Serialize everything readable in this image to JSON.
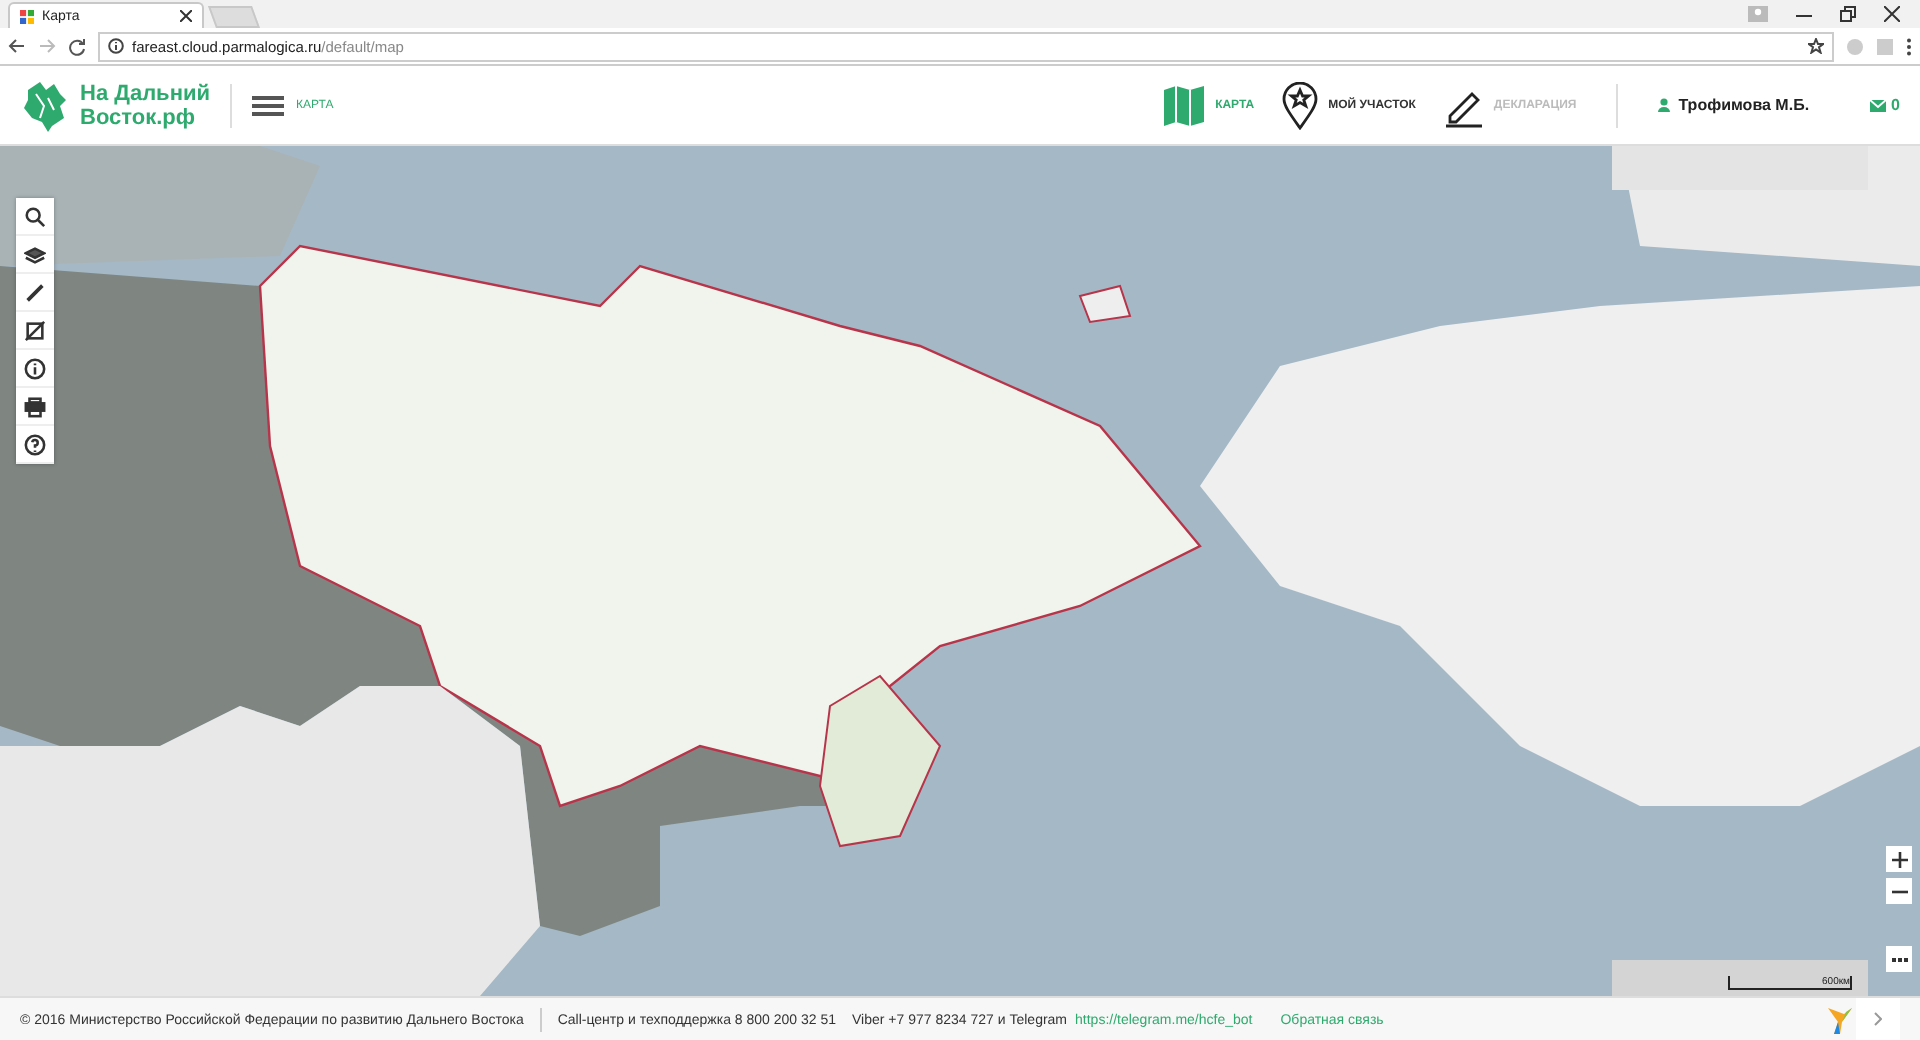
{
  "browser": {
    "tab_title": "Карта",
    "url_host": "fareast.cloud.parmalogica.ru",
    "url_path": "/default/map"
  },
  "header": {
    "logo_line1": "На Дальний",
    "logo_line2": "Восток.рф",
    "section": "КАРТА",
    "nav": [
      {
        "label": "КАРТА",
        "selected": true,
        "disabled": false
      },
      {
        "label": "МОЙ УЧАСТОК",
        "selected": false,
        "disabled": false
      },
      {
        "label": "ДЕКЛАРАЦИЯ",
        "selected": false,
        "disabled": true
      }
    ],
    "user": "Трофимова М.Б.",
    "messages": "0"
  },
  "map": {
    "scale": "600км"
  },
  "footer": {
    "copyright": "© 2016 Министерство Российской Федерации по развитию Дальнего Востока",
    "support": "Call-центр и техподдержка 8 800 200 32 51",
    "contacts": "Viber +7 977 8234 727 и Telegram",
    "telegram_link": "https://telegram.me/hcfe_bot",
    "feedback": "Обратная связь"
  }
}
